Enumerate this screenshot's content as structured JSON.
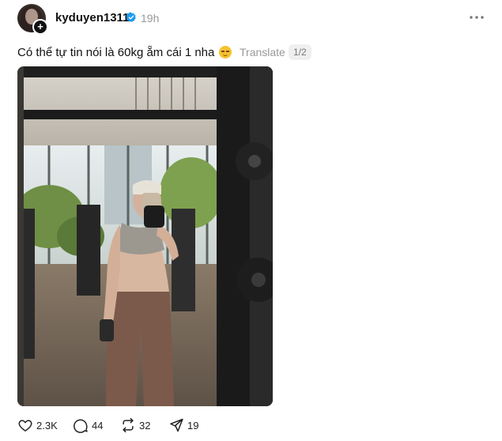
{
  "post": {
    "username": "kyduyen1311",
    "time_ago": "19h",
    "caption": "Có thể tự tin nói là 60kg ẵm cái 1 nha",
    "caption_emoji": "relieved-face-emoji",
    "translate_label": "Translate",
    "page_indicator": "1/2",
    "follow_symbol": "+"
  },
  "actions": {
    "likes": "2.3K",
    "comments": "44",
    "reposts": "32",
    "shares": "19"
  },
  "colors": {
    "text": "#111111",
    "muted": "#999999",
    "verified": "#1d9bf0"
  }
}
